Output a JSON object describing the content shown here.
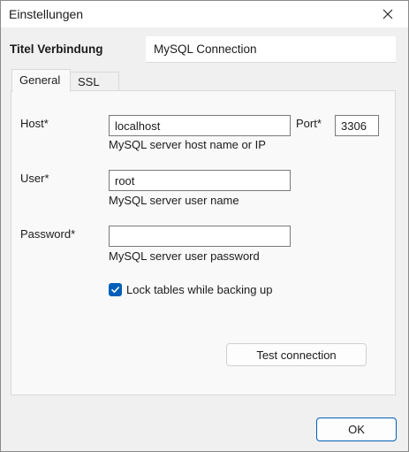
{
  "window": {
    "title": "Einstellungen"
  },
  "connection": {
    "label": "Titel Verbindung",
    "value": "MySQL Connection"
  },
  "tabs": [
    {
      "label": "General",
      "selected": true
    },
    {
      "label": "SSL",
      "selected": false
    }
  ],
  "host": {
    "label": "Host*",
    "value": "localhost",
    "hint": "MySQL server host name or IP"
  },
  "port": {
    "label": "Port*",
    "value": "3306"
  },
  "user": {
    "label": "User*",
    "value": "root",
    "hint": "MySQL server user name"
  },
  "password": {
    "label": "Password*",
    "value": "",
    "hint": "MySQL server user password"
  },
  "lock_tables": {
    "label": "Lock tables while backing up",
    "checked": true
  },
  "buttons": {
    "test": "Test connection",
    "ok": "OK"
  },
  "colors": {
    "accent": "#005fb8",
    "window_bg": "#f0f0f0",
    "panel_bg": "#f9f9f9"
  },
  "icons": {
    "close": "close-icon",
    "check": "checkmark-icon"
  }
}
